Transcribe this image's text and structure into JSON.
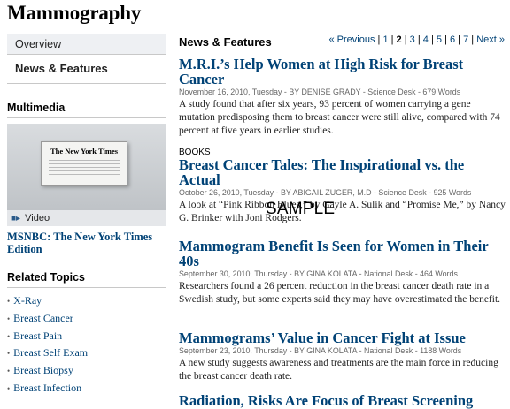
{
  "page_title": "Mammography",
  "left": {
    "nav": [
      {
        "label": "Overview"
      },
      {
        "label": "News & Features"
      }
    ],
    "multimedia": {
      "heading": "Multimedia",
      "thumb_label": "The New York Times",
      "video_label": "Video",
      "link_title": "MSNBC: The New York Times Edition"
    },
    "related": {
      "heading": "Related Topics",
      "items": [
        {
          "label": "X-Ray"
        },
        {
          "label": "Breast Cancer"
        },
        {
          "label": "Breast Pain"
        },
        {
          "label": "Breast Self Exam"
        },
        {
          "label": "Breast Biopsy"
        },
        {
          "label": "Breast Infection"
        }
      ]
    }
  },
  "main": {
    "heading": "News & Features",
    "pager": {
      "prev": "« Previous",
      "pages": [
        "1",
        "2",
        "3",
        "4",
        "5",
        "6",
        "7"
      ],
      "current": "2",
      "next": "Next »"
    },
    "articles": [
      {
        "kicker": "",
        "title": "M.R.I.’s Help Women at High Risk for Breast Cancer",
        "meta": "November 16, 2010, Tuesday - BY DENISE GRADY - Science Desk - 679 Words",
        "summary": "A study found that after six years, 93 percent of women carrying a gene mutation predisposing them to breast cancer were still alive, compared with 74 percent at five years in earlier studies."
      },
      {
        "kicker": "BOOKS",
        "title": "Breast Cancer Tales: The Inspirational vs. the Actual",
        "meta": "October 26, 2010, Tuesday - BY ABIGAIL ZUGER, M.D - Science Desk - 925 Words",
        "summary": "A look at “Pink Ribbon Blues,” by Gayle A. Sulik and “Promise Me,” by Nancy G. Brinker with Joni Rodgers."
      },
      {
        "kicker": "",
        "title": "Mammogram Benefit Is Seen for Women in Their 40s",
        "meta": "September 30, 2010, Thursday - BY GINA KOLATA - National Desk - 464 Words",
        "summary": "Researchers found a 26 percent reduction in the breast cancer death rate in a Swedish study, but some experts said they may have overestimated the benefit."
      },
      {
        "kicker": "",
        "title": "Mammograms’ Value in Cancer Fight at Issue",
        "meta": "September 23, 2010, Thursday - BY GINA KOLATA - National Desk - 1188 Words",
        "summary": "A new study suggests awareness and treatments are the main force in reducing the breast cancer death rate."
      },
      {
        "kicker": "",
        "title": "Radiation, Risks Are Focus of Breast Screening",
        "meta": "",
        "summary": ""
      }
    ]
  },
  "watermark": "SAMPLE"
}
